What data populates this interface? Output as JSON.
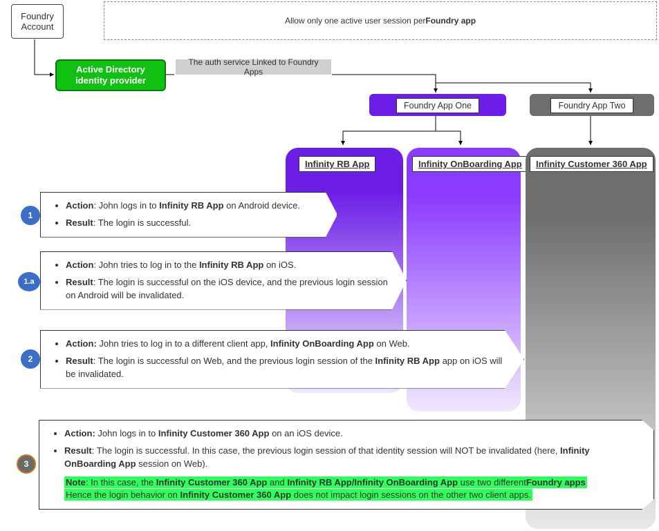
{
  "account_box": "Foundry Account",
  "rule_box": {
    "prefix": "Allow only one active user session per",
    "bold": "Foundry app"
  },
  "idp_box": "Active Directory identity provider",
  "auth_label": "The auth service Linked to Foundry Apps",
  "app_one_card": "Foundry App One",
  "app_two_card": "Foundry App Two",
  "client_app_rb": "Infinity RB App",
  "client_app_onb": "Infinity OnBoarding App",
  "client_app_c360": "Infinity Customer 360 App",
  "badges": {
    "s1": "1",
    "s1a": "1.a",
    "s2": "2",
    "s3": "3"
  },
  "step1": {
    "action_label": "Action",
    "action_pre": ": John logs in to ",
    "action_app": "Infinity RB App",
    "action_post": " on Android device.",
    "result_label": "Result",
    "result_text": ": The login is successful."
  },
  "step1a": {
    "action_label": "Action",
    "action_pre": ": John tries to log in to the ",
    "action_app": "Infinity RB App",
    "action_post": " on iOS.",
    "result_label": "Result",
    "result_text": ": The login is successful on the iOS device, and the previous login session on Android will be invalidated."
  },
  "step2": {
    "action_label": "Action:",
    "action_pre": " John tries to log in to a different client app, ",
    "action_app": "Infinity OnBoarding App",
    "action_post": " on Web.",
    "result_label": "Result",
    "result_pre": ": The login is successful on Web, and the previous login session of the ",
    "result_app": "Infinity RB App",
    "result_post": " app on iOS will be invalidated."
  },
  "step3": {
    "action_label": "Action:",
    "action_pre": " John logs in to ",
    "action_app": "Infinity Customer 360 App",
    "action_post": " on an iOS device.",
    "result_label": "Result",
    "result_pre": ": The login is successful. In this case, the previous login session of that identity session will NOT be invalidated (here, ",
    "result_app": "Infinity OnBoarding App",
    "result_post": " session on Web).",
    "note_label": "Note",
    "note_pre": ": In this case, the ",
    "note_app1": "Infinity Customer 360 App",
    "note_and": " and ",
    "note_app2": "Infinity RB App/Infinity OnBoarding App",
    "note_mid": " use two different",
    "note_bold_mid": "Foundry apps",
    "note_tail_pre": " Hence the login behavior on ",
    "note_tail_app": "Infinity Customer 360 App",
    "note_tail_post": " does not impact login sessions on the other two client apps."
  }
}
